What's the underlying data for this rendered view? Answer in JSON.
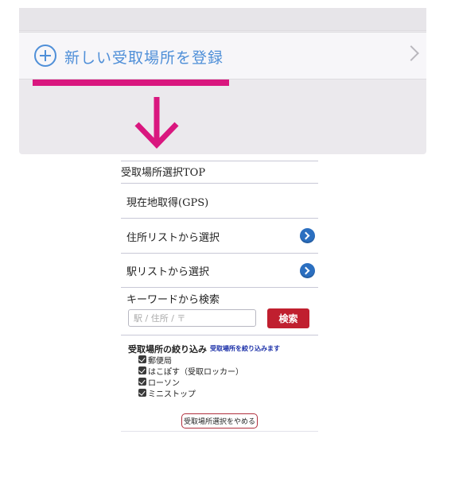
{
  "register_row": {
    "label": "新しい受取場所を登録",
    "icon": "plus-circle-icon",
    "chevron": "chevron-right-icon"
  },
  "colors": {
    "accent_blue": "#4f8fd8",
    "highlight_magenta": "#d9177f",
    "search_red": "#c01f2f",
    "go_blue": "#2b6fc0"
  },
  "selector": {
    "title": "受取場所選択TOP",
    "menu": [
      {
        "label": "現在地取得(GPS)"
      },
      {
        "label": "住所リストから選択",
        "icon": "arrow-right-circle-icon"
      },
      {
        "label": "駅リストから選択",
        "icon": "arrow-right-circle-icon"
      }
    ],
    "keyword": {
      "label": "キーワードから検索",
      "placeholder": "駅 / 住所 / 〒",
      "value": "",
      "button": "検索"
    },
    "filter": {
      "title": "受取場所の絞り込み",
      "link": "受取場所を絞り込みます",
      "options": [
        {
          "label": "郵便局",
          "checked": true
        },
        {
          "label": "はこぽす（受取ロッカー）",
          "checked": true
        },
        {
          "label": "ローソン",
          "checked": true
        },
        {
          "label": "ミニストップ",
          "checked": true
        }
      ]
    },
    "cancel_button": "受取場所選択をやめる"
  }
}
